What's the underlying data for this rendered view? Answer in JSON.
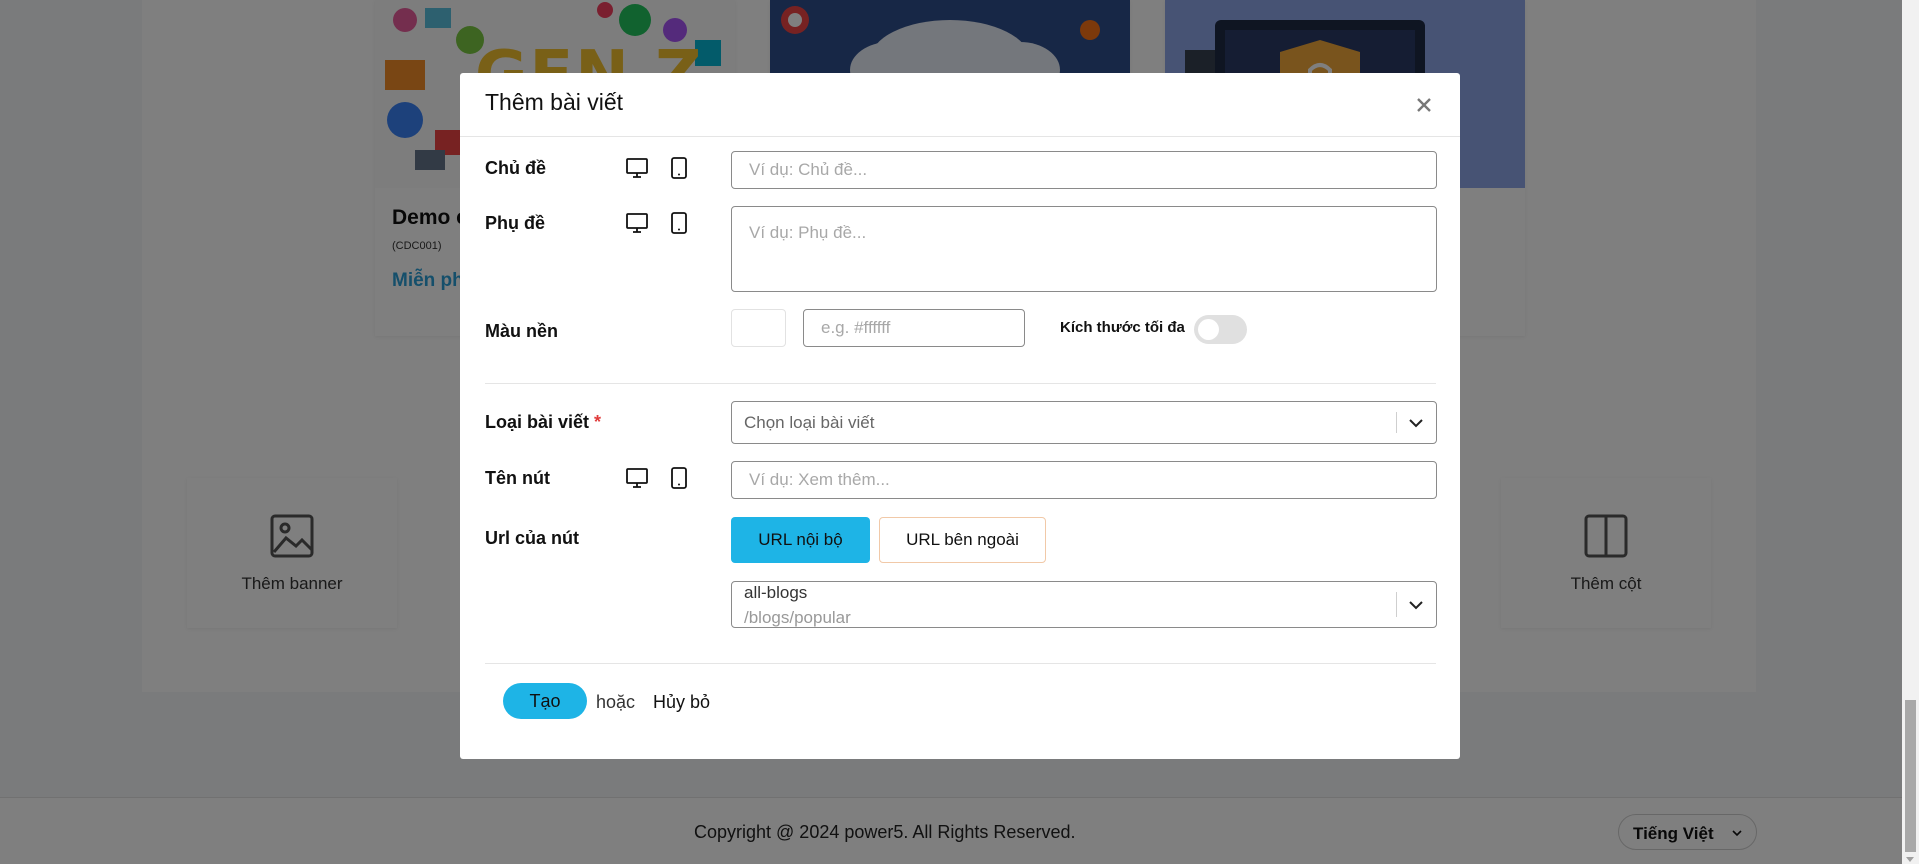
{
  "background": {
    "cards": [
      {
        "title": "Demo c",
        "code": "(CDC001)",
        "price": "Miễn ph",
        "image": "gen-z-illustration",
        "image_text": "GEN Z"
      },
      {
        "image": "cloud-network-illustration"
      },
      {
        "image": "security-lock-illustration"
      }
    ],
    "tiles": [
      {
        "label": "Thêm banner",
        "icon": "image-icon"
      },
      {
        "label": "Thêm cột",
        "icon": "columns-icon"
      }
    ],
    "footer": {
      "copyright": "Copyright @ 2024 power5. All Rights Reserved.",
      "language": "Tiếng Việt"
    }
  },
  "modal": {
    "title": "Thêm bài viết",
    "fields": {
      "topic": {
        "label": "Chủ đề",
        "placeholder": "Ví dụ: Chủ đề..."
      },
      "subtitle": {
        "label": "Phụ đề",
        "placeholder": "Ví dụ: Phụ đề..."
      },
      "bg_color": {
        "label": "Màu nền",
        "placeholder": "e.g. #ffffff",
        "max_size_label": "Kích thước tối đa",
        "max_size_on": false
      },
      "post_type": {
        "label": "Loại bài viết",
        "required_mark": "*",
        "placeholder": "Chọn loại bài viết"
      },
      "button_name": {
        "label": "Tên nút",
        "placeholder": "Ví dụ: Xem thêm..."
      },
      "button_url": {
        "label": "Url của nút",
        "internal_label": "URL nội bộ",
        "external_label": "URL bên ngoài",
        "selected_name": "all-blogs",
        "selected_path": "/blogs/popular"
      }
    },
    "footer": {
      "create_label": "Tạo",
      "or_label": "hoặc",
      "cancel_label": "Hủy bỏ"
    }
  },
  "colors": {
    "accent": "#1eb4e6",
    "required": "#e03a3a",
    "overlay": "rgba(0,0,0,0.5)"
  }
}
